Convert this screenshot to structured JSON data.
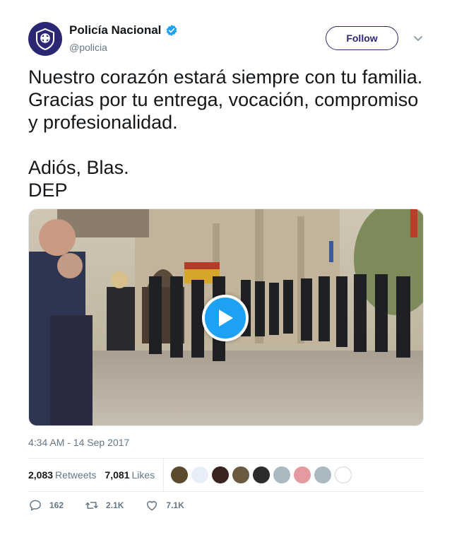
{
  "header": {
    "display_name": "Policía Nacional",
    "handle": "@policia",
    "follow_label": "Follow",
    "verified": true
  },
  "tweet": {
    "text": "Nuestro corazón estará siempre con tu familia. Gracias por tu entrega, vocación, compromiso y profesionalidad.\n\nAdiós, Blas.\nDEP",
    "timestamp": "4:34 AM - 14 Sep 2017"
  },
  "stats": {
    "retweets_count": "2,083",
    "retweets_label": "Retweets",
    "likes_count": "7,081",
    "likes_label": "Likes"
  },
  "actions": {
    "reply_count": "162",
    "retweet_count": "2.1K",
    "like_count": "7.1K"
  },
  "colors": {
    "brand": "#2b2774",
    "play": "#1da1f2",
    "muted": "#657786",
    "text": "#14171a"
  },
  "icons": [
    "verified-badge-icon",
    "chevron-down-icon",
    "play-icon",
    "reply-icon",
    "retweet-icon",
    "like-icon"
  ]
}
